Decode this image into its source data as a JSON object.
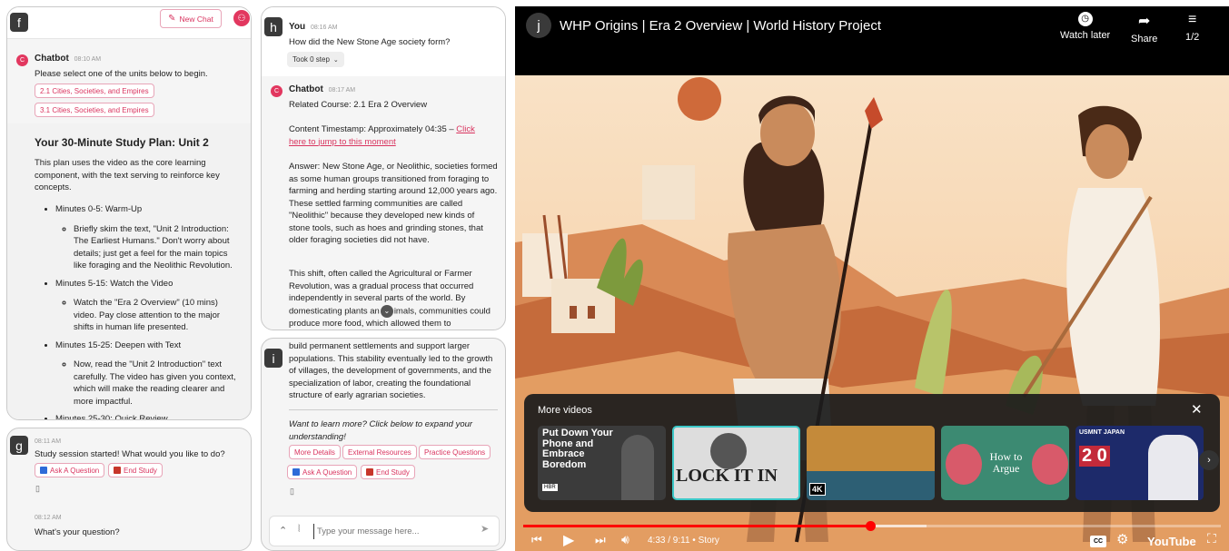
{
  "panel_f": {
    "tag": "f",
    "new_chat_label": "New Chat",
    "chatbot": {
      "name": "Chatbot",
      "time": "08:10 AM",
      "avatar": "C",
      "prompt": "Please select one of the units below to begin."
    },
    "units": [
      "2.1 Cities, Societies, and Empires",
      "3.1 Cities, Societies, and Empires"
    ],
    "plan": {
      "title": "Your 30-Minute Study Plan: Unit 2",
      "intro": "This plan uses the video as the core learning component, with the text serving to reinforce key concepts.",
      "items": [
        {
          "label": "Minutes 0-5: Warm-Up",
          "sub": "Briefly skim the text, \"Unit 2 Introduction: The Earliest Humans.\" Don't worry about details; just get a feel for the main topics like foraging and the Neolithic Revolution."
        },
        {
          "label": "Minutes 5-15: Watch the Video",
          "sub": "Watch the \"Era 2 Overview\" (10 mins) video. Pay close attention to the major shifts in human life presented."
        },
        {
          "label": "Minutes 15-25: Deepen with Text",
          "sub": "Now, read the \"Unit 2 Introduction\" text carefully. The video has given you context, which will make the reading clearer and more impactful."
        },
        {
          "label": "Minutes 25-30: Quick Review",
          "sub": ""
        }
      ]
    }
  },
  "panel_g": {
    "tag": "g",
    "time1": "08:11 AM",
    "message": "Study session started! What would you like to do?",
    "ask_label": "Ask A Question",
    "end_label": "End Study",
    "time2": "08:12 AM",
    "question": "What's your question?"
  },
  "panel_h": {
    "tag": "h",
    "user": {
      "name": "You",
      "time": "08:16 AM",
      "message": "How did the New Stone Age society form?"
    },
    "steps_label": "Took 0 step",
    "chatbot": {
      "name": "Chatbot",
      "time": "08:17 AM",
      "avatar": "C"
    },
    "related_course": "Related Course: 2.1 Era 2 Overview",
    "timestamp_text": "Content Timestamp: Approximately 04:35 – ",
    "timestamp_link": "Click here to jump to this moment",
    "answer": "Answer: New Stone Age, or Neolithic, societies formed as some human groups transitioned from foraging to farming and herding starting around 12,000 years ago. These settled farming communities are called \"Neolithic\" because they developed new kinds of stone tools, such as hoes and grinding stones, that older foraging societies did not have.",
    "shift_a": "This shift, often called the Agricultural or Farmer Revolution, was a gradual process that occurred independently in several parts of the world. By domesticating plants an",
    "shift_b": "imals, communities could produce more food, which allowed them to"
  },
  "panel_i": {
    "tag": "i",
    "continued": "build permanent settlements and support larger populations. This stability eventually led to the growth of villages, the development of governments, and the specialization of labor, creating the foundational structure of early agrarian societies.",
    "learn_more": "Want to learn more? Click below to expand your understanding!",
    "buttons": [
      "More Details",
      "External Resources",
      "Practice Questions"
    ],
    "ask_label": "Ask A Question",
    "end_label": "End Study",
    "input_placeholder": "Type your message here..."
  },
  "video": {
    "channel_initial": "j",
    "title": "WHP Origins | Era 2 Overview | World History Project",
    "watch_later": "Watch later",
    "share": "Share",
    "playlist": "1/2",
    "more_videos": "More videos",
    "thumbs": [
      {
        "text": "Put Down Your Phone and Embrace Boredom",
        "badge": "HBR"
      },
      {
        "text": "LOCK IT IN",
        "badge": ""
      },
      {
        "text": "",
        "badge": "4K"
      },
      {
        "text": "How to Argue",
        "badge": ""
      },
      {
        "text": "2 0",
        "badge": "USMNT JAPAN"
      }
    ],
    "time_display": "4:33 / 9:11",
    "chapter": "Story",
    "progress": 0.498,
    "brand": "YouTube",
    "colors": {
      "progress": "#ff0000",
      "accent": "#e2375f"
    }
  }
}
